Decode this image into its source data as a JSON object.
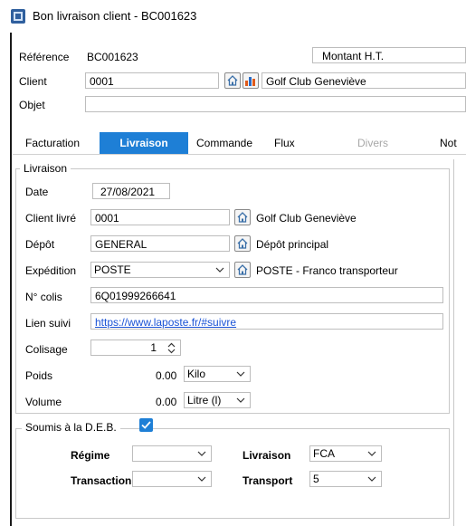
{
  "window": {
    "title": "Bon livraison client - BC001623"
  },
  "header": {
    "reference_label": "Référence",
    "reference_value": "BC001623",
    "montant_label": "Montant H.T.",
    "client_label": "Client",
    "client_code": "0001",
    "client_name": "Golf Club Geneviève",
    "objet_label": "Objet",
    "objet_value": ""
  },
  "tabs": [
    {
      "label": "Facturation"
    },
    {
      "label": "Livraison"
    },
    {
      "label": "Commande"
    },
    {
      "label": "Flux"
    },
    {
      "label": "Divers"
    },
    {
      "label": "Not"
    }
  ],
  "livraison": {
    "legend": "Livraison",
    "date_label": "Date",
    "date_value": "27/08/2021",
    "client_livre_label": "Client livré",
    "client_livre_code": "0001",
    "client_livre_name": "Golf Club Geneviève",
    "depot_label": "Dépôt",
    "depot_code": "GENERAL",
    "depot_name": "Dépôt principal",
    "expedition_label": "Expédition",
    "expedition_value": "POSTE",
    "expedition_name": "POSTE  - Franco transporteur",
    "colis_label": "N° colis",
    "colis_value": "6Q01999266641",
    "lien_label": "Lien suivi",
    "lien_value": "https://www.laposte.fr/#suivre",
    "colisage_label": "Colisage",
    "colisage_value": "1",
    "poids_label": "Poids",
    "poids_value": "0.00",
    "poids_unit": "Kilo",
    "volume_label": "Volume",
    "volume_value": "0.00",
    "volume_unit": "Litre (l)"
  },
  "deb": {
    "legend": "Soumis à la D.E.B.",
    "checked": true,
    "regime_label": "Régime",
    "regime_value": "",
    "livraison_label": "Livraison",
    "livraison_value": "FCA",
    "transaction_label": "Transaction",
    "transaction_value": "",
    "transport_label": "Transport",
    "transport_value": "5"
  },
  "colors": {
    "accent": "#1e7fd6",
    "link": "#1a53d6",
    "checkbox": "#1e7fd6"
  }
}
